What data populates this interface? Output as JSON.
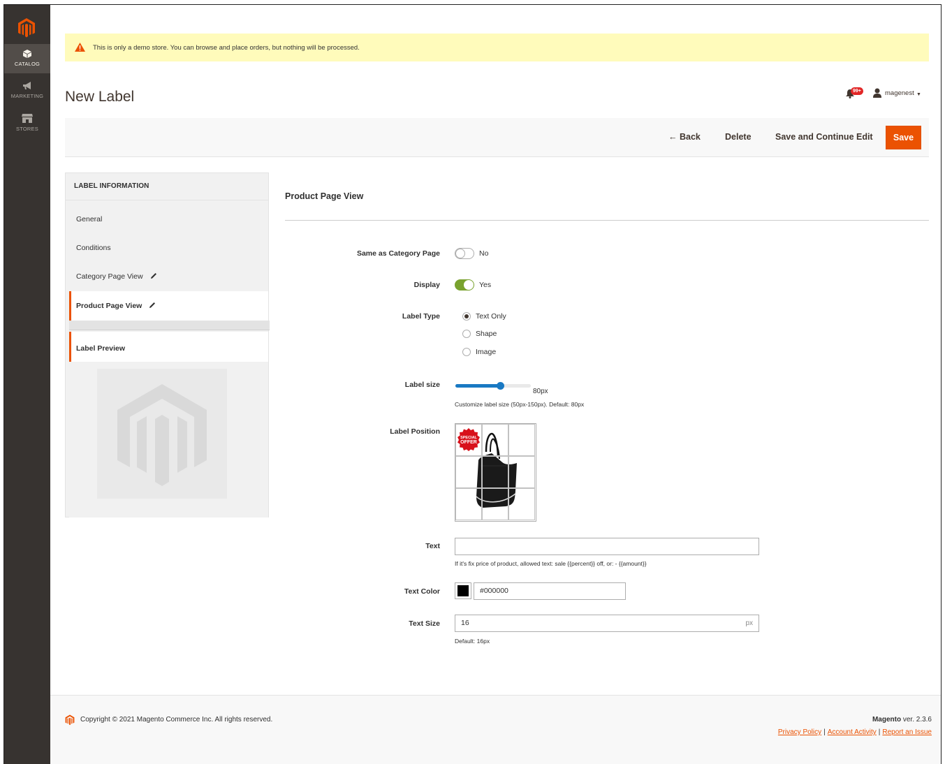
{
  "sidebar": {
    "items": [
      {
        "label": "CATALOG",
        "icon": "box-icon"
      },
      {
        "label": "MARKETING",
        "icon": "megaphone-icon"
      },
      {
        "label": "STORES",
        "icon": "store-icon"
      }
    ]
  },
  "notice": {
    "text": "This is only a demo store. You can browse and place orders, but nothing will be processed."
  },
  "header": {
    "title": "New Label",
    "notifications_count": "99+",
    "user_name": "magenest"
  },
  "actions": {
    "back_label": "Back",
    "delete_label": "Delete",
    "save_continue_label": "Save and Continue Edit",
    "save_label": "Save"
  },
  "left_panel": {
    "heading": "LABEL INFORMATION",
    "items": [
      "General",
      "Conditions",
      "Category Page View",
      "Product Page View"
    ],
    "preview_title": "Label Preview"
  },
  "form": {
    "section_title": "Product Page View",
    "same_as_category": {
      "label": "Same as Category Page",
      "value": "No"
    },
    "display": {
      "label": "Display",
      "value": "Yes"
    },
    "label_type": {
      "label": "Label Type",
      "options": [
        "Text Only",
        "Shape",
        "Image"
      ],
      "selected": "Text Only"
    },
    "label_size": {
      "label": "Label size",
      "value_text": "80px",
      "value": 80,
      "min": 50,
      "max": 150,
      "note": "Customize label size (50px-150px). Default: 80px"
    },
    "label_position": {
      "label": "Label Position",
      "badge_text_1": "SPECIAL",
      "badge_text_2": "OFFER"
    },
    "text": {
      "label": "Text",
      "value": "",
      "note": "If it's fix price of product, allowed text: sale {{percent}} off, or: - {{amount}}"
    },
    "text_color": {
      "label": "Text Color",
      "value": "#000000"
    },
    "text_size": {
      "label": "Text Size",
      "value": "16",
      "suffix": "px",
      "note": "Default: 16px"
    }
  },
  "footer": {
    "copyright": "Copyright © 2021 Magento Commerce Inc. All rights reserved.",
    "brand": "Magento",
    "version": " ver. 2.3.6",
    "links": [
      "Privacy Policy",
      "Account Activity",
      "Report an Issue"
    ]
  },
  "colors": {
    "accent": "#eb5202",
    "sidebar_bg": "#373330",
    "toggle_on": "#79a22e",
    "slider": "#1979c3"
  }
}
